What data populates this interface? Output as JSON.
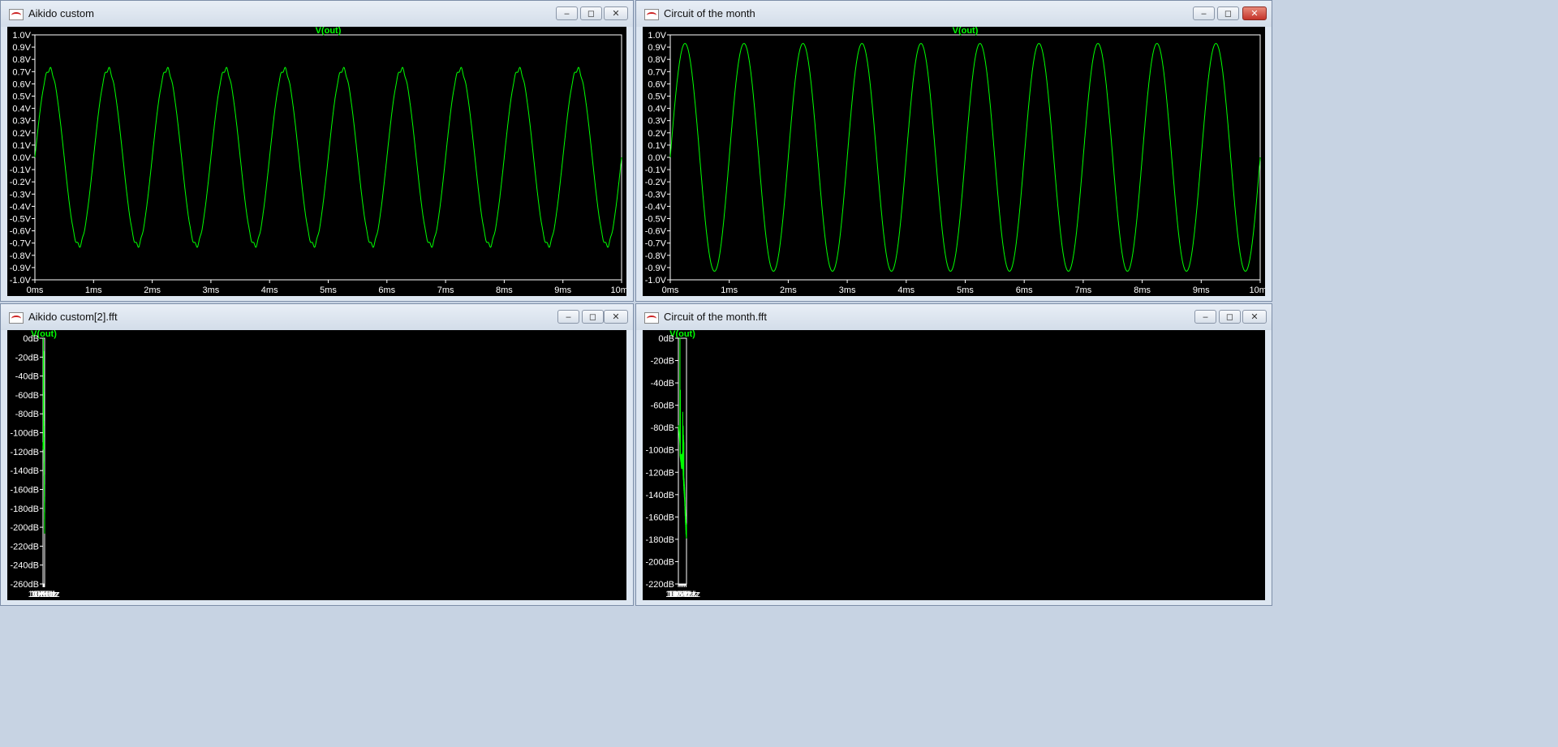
{
  "windows": [
    {
      "title": "Aikido custom",
      "trace_label": "V(out)",
      "y_ticks": [
        "1.0V",
        "0.9V",
        "0.8V",
        "0.7V",
        "0.6V",
        "0.5V",
        "0.4V",
        "0.3V",
        "0.2V",
        "0.1V",
        "0.0V",
        "-0.1V",
        "-0.2V",
        "-0.3V",
        "-0.4V",
        "-0.5V",
        "-0.6V",
        "-0.7V",
        "-0.8V",
        "-0.9V",
        "-1.0V"
      ],
      "x_ticks": [
        "0ms",
        "1ms",
        "2ms",
        "3ms",
        "4ms",
        "5ms",
        "6ms",
        "7ms",
        "8ms",
        "9ms",
        "10ms"
      ],
      "close_active": false
    },
    {
      "title": "Circuit of the month",
      "trace_label": "V(out)",
      "y_ticks": [
        "1.0V",
        "0.9V",
        "0.8V",
        "0.7V",
        "0.6V",
        "0.5V",
        "0.4V",
        "0.3V",
        "0.2V",
        "0.1V",
        "0.0V",
        "-0.1V",
        "-0.2V",
        "-0.3V",
        "-0.4V",
        "-0.5V",
        "-0.6V",
        "-0.7V",
        "-0.8V",
        "-0.9V",
        "-1.0V"
      ],
      "x_ticks": [
        "0ms",
        "1ms",
        "2ms",
        "3ms",
        "4ms",
        "5ms",
        "6ms",
        "7ms",
        "8ms",
        "9ms",
        "10ms"
      ],
      "close_active": true
    },
    {
      "title": "Aikido custom[2].fft",
      "trace_label": "V(out)",
      "y_ticks": [
        "0dB",
        "-20dB",
        "-40dB",
        "-60dB",
        "-80dB",
        "-100dB",
        "-120dB",
        "-140dB",
        "-160dB",
        "-180dB",
        "-200dB",
        "-220dB",
        "-240dB",
        "-260dB"
      ],
      "x_ticks": [
        "100Hz",
        "1KHz",
        "10KHz",
        "100KHz",
        "1MHz",
        "10MHz"
      ],
      "close_active": false
    },
    {
      "title": "Circuit of the month.fft",
      "trace_label": "V(out)",
      "y_ticks": [
        "0dB",
        "-20dB",
        "-40dB",
        "-60dB",
        "-80dB",
        "-100dB",
        "-120dB",
        "-140dB",
        "-160dB",
        "-180dB",
        "-200dB",
        "-220dB"
      ],
      "x_ticks": [
        "100Hz",
        "1KHz",
        "10KHz",
        "100KHz",
        "1MHz",
        "10MHz"
      ],
      "close_active": false
    }
  ],
  "controls": {
    "minimize": "‒",
    "restore": "◻",
    "close": "✕"
  },
  "colors": {
    "trace": "#00ff00",
    "axis": "#ffffff",
    "label": "#00ff00",
    "plot_bg": "#000000"
  },
  "chart_data": [
    {
      "type": "line",
      "title": "V(out)",
      "xlim": [
        0,
        10
      ],
      "x_unit": "ms",
      "ylim": [
        -1.0,
        1.0
      ],
      "y_unit": "V",
      "series": [
        {
          "name": "V(out)",
          "waveform": "sine",
          "amplitude": 0.72,
          "period_ms": 1.0,
          "phase_ms": 0.0,
          "ripple_amplitude": 0.02
        }
      ]
    },
    {
      "type": "line",
      "title": "V(out)",
      "xlim": [
        0,
        10
      ],
      "x_unit": "ms",
      "ylim": [
        -1.0,
        1.0
      ],
      "y_unit": "V",
      "series": [
        {
          "name": "V(out)",
          "waveform": "sine",
          "amplitude": 0.93,
          "period_ms": 1.0,
          "phase_ms": 0.0,
          "ripple_amplitude": 0
        }
      ]
    },
    {
      "type": "line",
      "title": "V(out)",
      "x_scale": "log",
      "xlim": [
        100,
        15000000
      ],
      "x_unit": "Hz",
      "ylim": [
        -260,
        0
      ],
      "y_unit": "dB",
      "series": [
        {
          "name": "V(out)",
          "floor": [
            [
              100,
              -110
            ],
            [
              200,
              -118
            ],
            [
              400,
              -115
            ],
            [
              1000,
              -112
            ],
            [
              3000,
              -108
            ],
            [
              10000,
              -103
            ],
            [
              30000,
              -98
            ],
            [
              70000,
              -100
            ],
            [
              150000,
              -112
            ],
            [
              400000,
              -132
            ],
            [
              1000000,
              -155
            ],
            [
              3000000,
              -175
            ],
            [
              15000000,
              -200
            ]
          ],
          "peaks": [
            [
              1000,
              -5
            ],
            [
              2000,
              -85
            ],
            [
              24000,
              -35
            ],
            [
              40000,
              -78
            ]
          ],
          "noise_db": 18
        }
      ]
    },
    {
      "type": "line",
      "title": "V(out)",
      "x_scale": "log",
      "xlim": [
        100,
        15000000
      ],
      "x_unit": "Hz",
      "ylim": [
        -220,
        0
      ],
      "y_unit": "dB",
      "series": [
        {
          "name": "V(out)",
          "floor": [
            [
              100,
              -78
            ],
            [
              300,
              -85
            ],
            [
              950,
              -95
            ],
            [
              1100,
              -105
            ],
            [
              3000,
              -108
            ],
            [
              10000,
              -112
            ],
            [
              30000,
              -112
            ],
            [
              60000,
              -108
            ],
            [
              70000,
              -100
            ],
            [
              100000,
              -118
            ],
            [
              300000,
              -130
            ],
            [
              1000000,
              -142
            ],
            [
              3000000,
              -160
            ],
            [
              8000000,
              -172
            ],
            [
              15000000,
              -175
            ]
          ],
          "peaks": [
            [
              1000,
              -5
            ],
            [
              2000,
              -68
            ],
            [
              60000,
              -88
            ],
            [
              120000,
              -100
            ],
            [
              180000,
              -108
            ],
            [
              250000,
              -112
            ],
            [
              320000,
              -115
            ]
          ],
          "noise_db": 12
        }
      ]
    }
  ]
}
